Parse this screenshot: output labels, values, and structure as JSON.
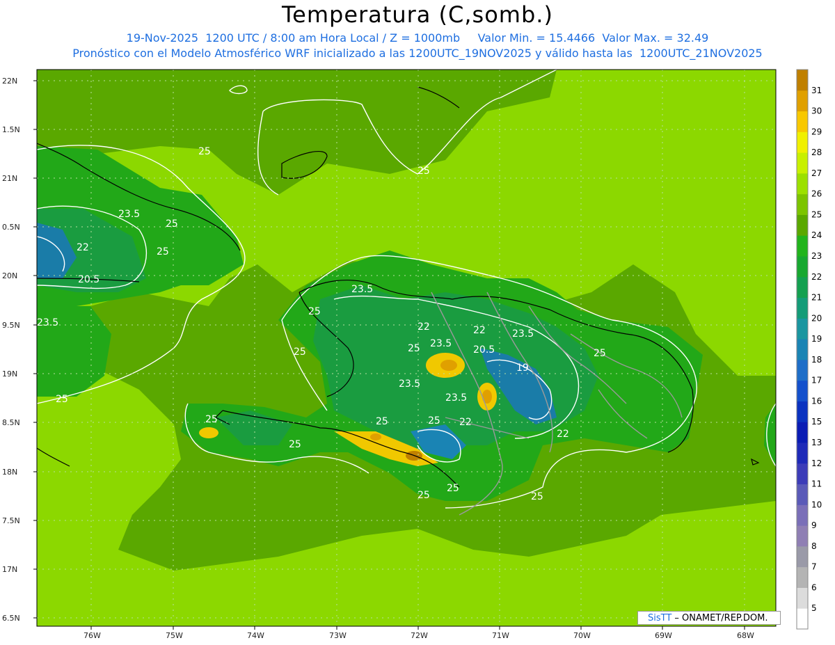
{
  "title": "Temperatura (C,somb.)",
  "subtitle_1": "19-Nov-2025  1200 UTC / 8:00 am Hora Local / Z = 1000mb     Valor Min. = 15.4466  Valor Max. = 32.49",
  "subtitle_2": "Pronóstico con el Modelo Atmosférico WRF inicializado a las 1200UTC_19NOV2025 y válido hasta las  1200UTC_21NOV2025",
  "lat_labels": [
    "22N",
    "1.5N",
    "21N",
    "0.5N",
    "20N",
    "9.5N",
    "19N",
    "8.5N",
    "18N",
    "7.5N",
    "17N",
    "6.5N"
  ],
  "lon_labels": [
    "76W",
    "75W",
    "74W",
    "73W",
    "72W",
    "71W",
    "70W",
    "69W",
    "68W"
  ],
  "colorbar": {
    "labels": [
      "5",
      "6",
      "7",
      "8",
      "9",
      "10",
      "11",
      "12",
      "13",
      "15",
      "16",
      "17",
      "18",
      "19",
      "20",
      "21",
      "22",
      "23",
      "24",
      "25",
      "26",
      "27",
      "28",
      "29",
      "30",
      "31"
    ],
    "colors": [
      "#ffffff",
      "#dcdcdc",
      "#b4b4b4",
      "#9a9aa8",
      "#8f7fb4",
      "#7a6fb8",
      "#5a5ab8",
      "#3c3cb8",
      "#1e2ab8",
      "#0a1cb4",
      "#0a32c0",
      "#1450cc",
      "#1e6ec8",
      "#1a84b4",
      "#1a96a0",
      "#149c78",
      "#14a050",
      "#18a830",
      "#22b41c",
      "#5aa800",
      "#7cc400",
      "#9ce000",
      "#c8f000",
      "#f0f000",
      "#f8c800",
      "#e0a000",
      "#c08000"
    ]
  },
  "contour_labels": [
    "25",
    "25",
    "23.5",
    "25",
    "22",
    "25",
    "20.5",
    "23.5",
    "25",
    "23.5",
    "25",
    "22",
    "20.5",
    "23.5",
    "25",
    "19",
    "23.5",
    "23.5",
    "22",
    "25",
    "25",
    "22",
    "23.5",
    "22",
    "25",
    "25",
    "25",
    "25",
    "25",
    "25",
    "25"
  ],
  "credit": {
    "brand": "SisTT",
    "rest": " – ONAMET/REP.DOM."
  },
  "colors": {
    "ocean_light": "#8cd800",
    "ocean_mid": "#5aa800",
    "land_green": "#22a818",
    "land_mid": "#1a9c40",
    "cold": "#1a7ca8",
    "warm": "#f0c800"
  }
}
